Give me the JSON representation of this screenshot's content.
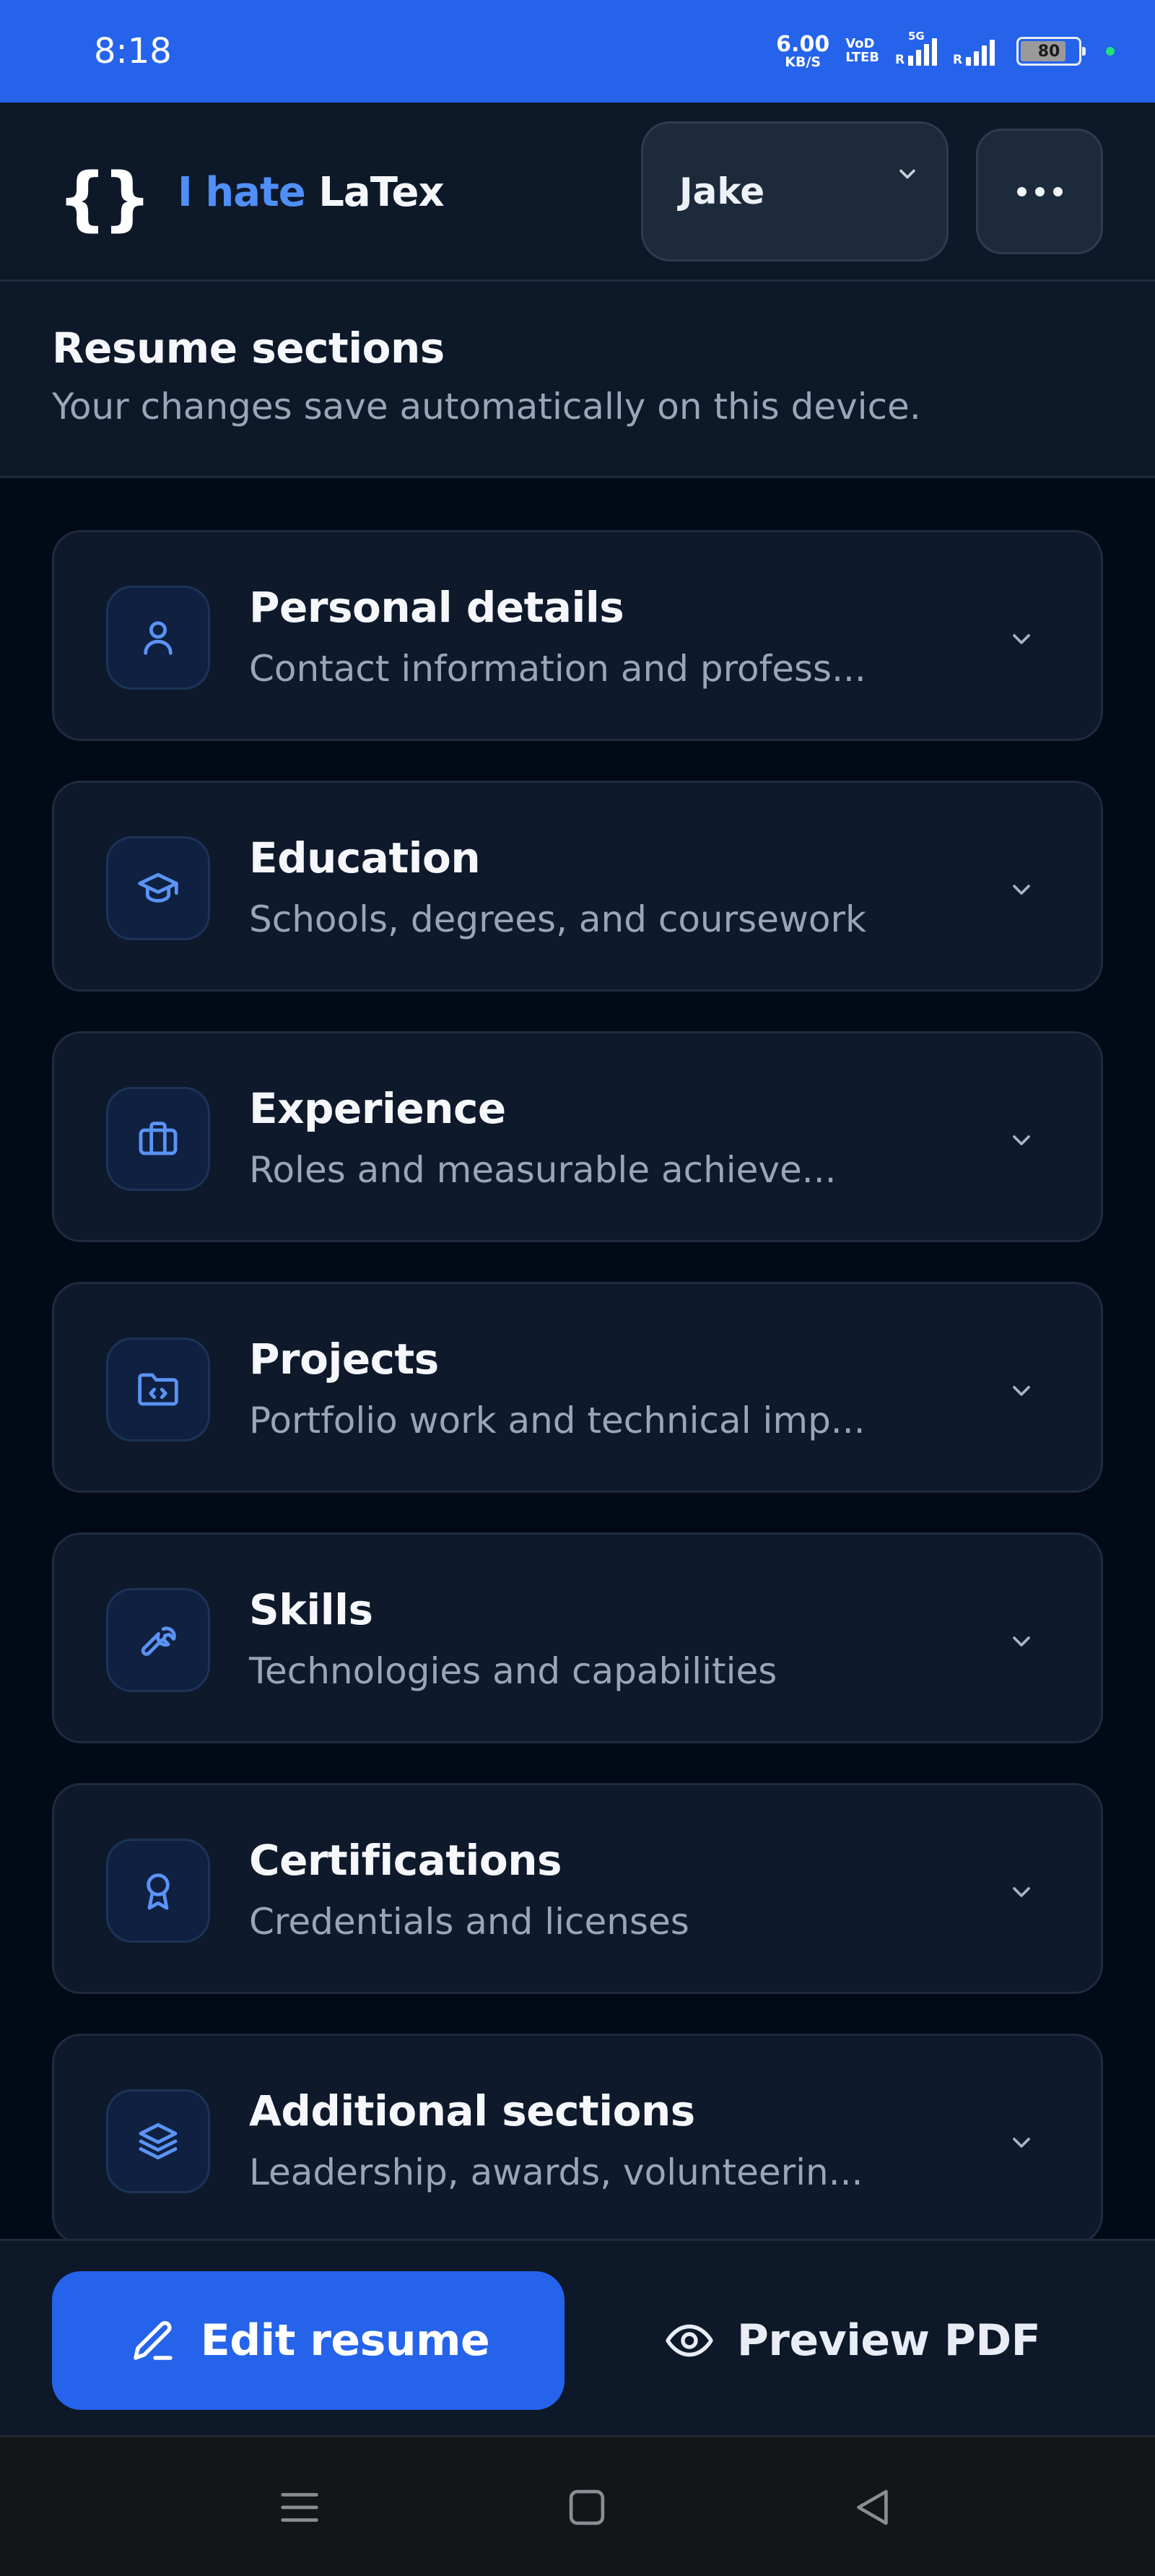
{
  "status_bar": {
    "time": "8:18",
    "net_speed_value": "6.00",
    "net_speed_unit": "KB/S",
    "volte_line1": "VoD",
    "volte_line2": "LTEB",
    "network_badge": "5G",
    "roaming_label": "R",
    "battery_level": "80",
    "battery_fraction": 0.8
  },
  "header": {
    "logo_icon": "curly-braces-icon",
    "logo_glyph": "{}",
    "brand_part1": "I hate",
    "brand_part2": "LaTex",
    "profile_name": "Jake",
    "more_icon": "more-horizontal-icon"
  },
  "section_header": {
    "title": "Resume sections",
    "subtitle": "Your changes save automatically on this device."
  },
  "sections": [
    {
      "title": "Personal details",
      "subtitle": "Contact information and profess...",
      "icon": "user-icon"
    },
    {
      "title": "Education",
      "subtitle": "Schools, degrees, and coursework",
      "icon": "graduation-cap-icon"
    },
    {
      "title": "Experience",
      "subtitle": "Roles and measurable achieve...",
      "icon": "briefcase-icon"
    },
    {
      "title": "Projects",
      "subtitle": "Portfolio work and technical imp...",
      "icon": "folder-code-icon"
    },
    {
      "title": "Skills",
      "subtitle": "Technologies and capabilities",
      "icon": "wrench-icon"
    },
    {
      "title": "Certifications",
      "subtitle": "Credentials and licenses",
      "icon": "award-icon"
    },
    {
      "title": "Additional sections",
      "subtitle": "Leadership, awards, volunteerin...",
      "icon": "layers-icon"
    }
  ],
  "actions": {
    "edit_label": "Edit resume",
    "preview_label": "Preview PDF"
  },
  "colors": {
    "accent": "#2563eb",
    "brand_blue": "#4f8ff7",
    "background": "#030a17",
    "card": "#0e192b"
  }
}
